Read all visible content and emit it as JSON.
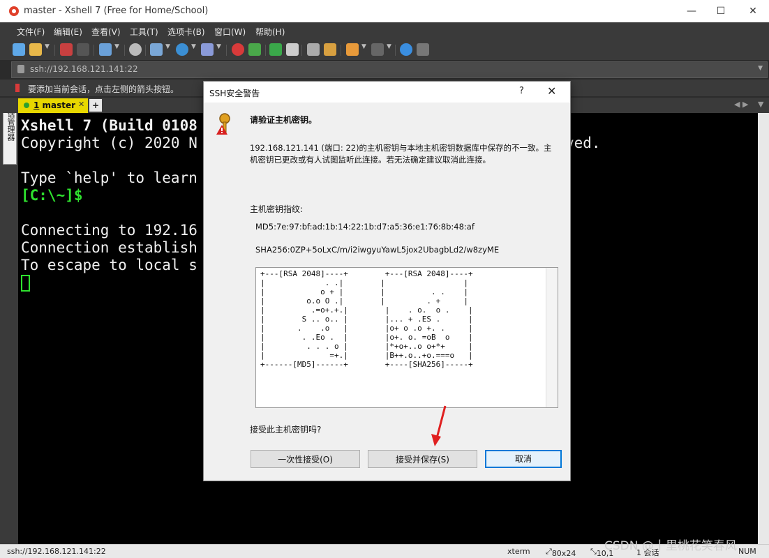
{
  "window": {
    "title": "master - Xshell 7 (Free for Home/School)",
    "minimize": "—",
    "maximize": "☐",
    "close": "✕"
  },
  "menu": [
    "文件(F)",
    "编辑(E)",
    "查看(V)",
    "工具(T)",
    "选项卡(B)",
    "窗口(W)",
    "帮助(H)"
  ],
  "address": {
    "value": "ssh://192.168.121.141:22"
  },
  "hint": "要添加当前会话，点击左侧的箭头按钮。",
  "tabs": [
    {
      "index": "1",
      "label": "master",
      "close": "✕"
    }
  ],
  "tab_add": "+",
  "left_strip_label": "会话管理器",
  "terminal": {
    "line1": "Xshell 7 (Build 0108",
    "line1_tail": "",
    "line2": "Copyright (c) 2020 N",
    "line2_tail": "ved.",
    "line3": "Type `help' to learn",
    "prompt": "[C:\\~]$",
    "line5": "Connecting to 192.16",
    "line6": "Connection establish",
    "line7": "To escape to local s"
  },
  "dialog": {
    "title": "SSH安全警告",
    "help": "?",
    "close": "✕",
    "heading": "请验证主机密钥。",
    "body_line1": "192.168.121.141 (端口: 22)的主机密钥与本地主机密钥数据库中保存的不一致。主",
    "body_line2": "机密钥已更改或有人试图监听此连接。若无法确定建议取消此连接。",
    "fp_label": "主机密钥指纹:",
    "md5": "MD5:7e:97:bf:ad:1b:14:22:1b:d7:a5:36:e1:76:8b:48:af",
    "sha256": "SHA256:0ZP+5oLxC/m/i2iwgyuYawL5jox2UbagbLd2/w8zyME",
    "randomart": "+---[RSA 2048]----+        +---[RSA 2048]----+\n|             . .|        |                 |\n|            o + |        |          . .    |\n|         o.o O .|        |         . +     |\n|          .=o+.+.|        |    . o.  o .    |\n|        S .. o.. |        |... + .ES .      |\n|       .    .o   |        |o+ o .o +. .     |\n|        . .Eo .  |        |o+. o. =oB  o    |\n|         . . . o |        |*+o+..o o+*+     |\n|              =+.|        |B++.o..+o.===o   |\n+------[MD5]------+        +----[SHA256]-----+",
    "question": "接受此主机密钥吗?",
    "btn_once": "一次性接受(O)",
    "btn_save": "接受并保存(S)",
    "btn_cancel": "取消"
  },
  "status": {
    "left": "ssh://192.168.121.141:22",
    "term": "xterm",
    "size": "80x24",
    "pos": "10,1",
    "sessions": "1 会话",
    "num": "NUM"
  },
  "watermark": "CSDN @十里桃花笑春风",
  "colors": {
    "accent": "#0078d7",
    "tab": "#e8d700",
    "prompt": "#2ee02e",
    "arrow": "#e02020"
  }
}
